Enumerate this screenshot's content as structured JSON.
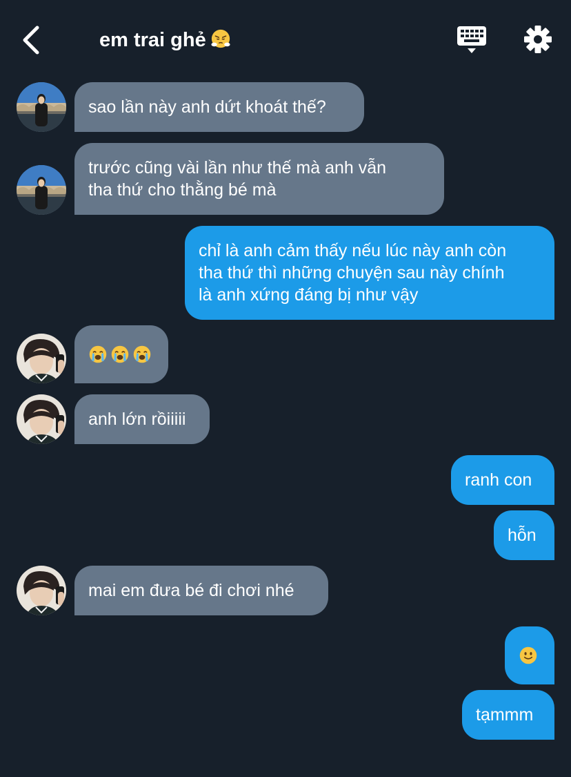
{
  "header": {
    "title": "em trai ghẻ",
    "title_emoji": "face-with-steam-emoji",
    "back_icon": "chevron-left-icon",
    "keyboard_icon": "keyboard-icon",
    "settings_icon": "gear-icon"
  },
  "colors": {
    "background": "#17202b",
    "incoming_bubble": "#66778a",
    "outgoing_bubble": "#1c9be8",
    "text": "#ffffff"
  },
  "messages": [
    {
      "side": "in",
      "avatar": "avatar-bridge",
      "text": "sao lần này anh dứt khoát thế?"
    },
    {
      "side": "in",
      "avatar": "avatar-bridge",
      "lines": [
        "trước cũng vài lần như thế mà anh vẫn",
        "tha thứ cho thằng bé mà"
      ]
    },
    {
      "side": "out",
      "lines": [
        "chỉ là anh cảm thấy nếu lúc này anh còn",
        "tha thứ thì những chuyện sau này chính",
        "là anh xứng đáng bị như vậy"
      ]
    },
    {
      "side": "in",
      "avatar": "avatar-selfie",
      "emoji": [
        "crying-face-emoji",
        "crying-face-emoji",
        "crying-face-emoji"
      ]
    },
    {
      "side": "in",
      "avatar": "avatar-selfie",
      "text": "anh lớn rồiiiii"
    },
    {
      "side": "out",
      "text": "ranh con"
    },
    {
      "side": "out",
      "text": "hỗn"
    },
    {
      "side": "in",
      "avatar": "avatar-selfie",
      "text": "mai em đưa bé đi chơi nhé"
    },
    {
      "side": "out",
      "emoji": [
        "slightly-smiling-face-emoji"
      ]
    },
    {
      "side": "out",
      "text": "tạmmm"
    }
  ]
}
